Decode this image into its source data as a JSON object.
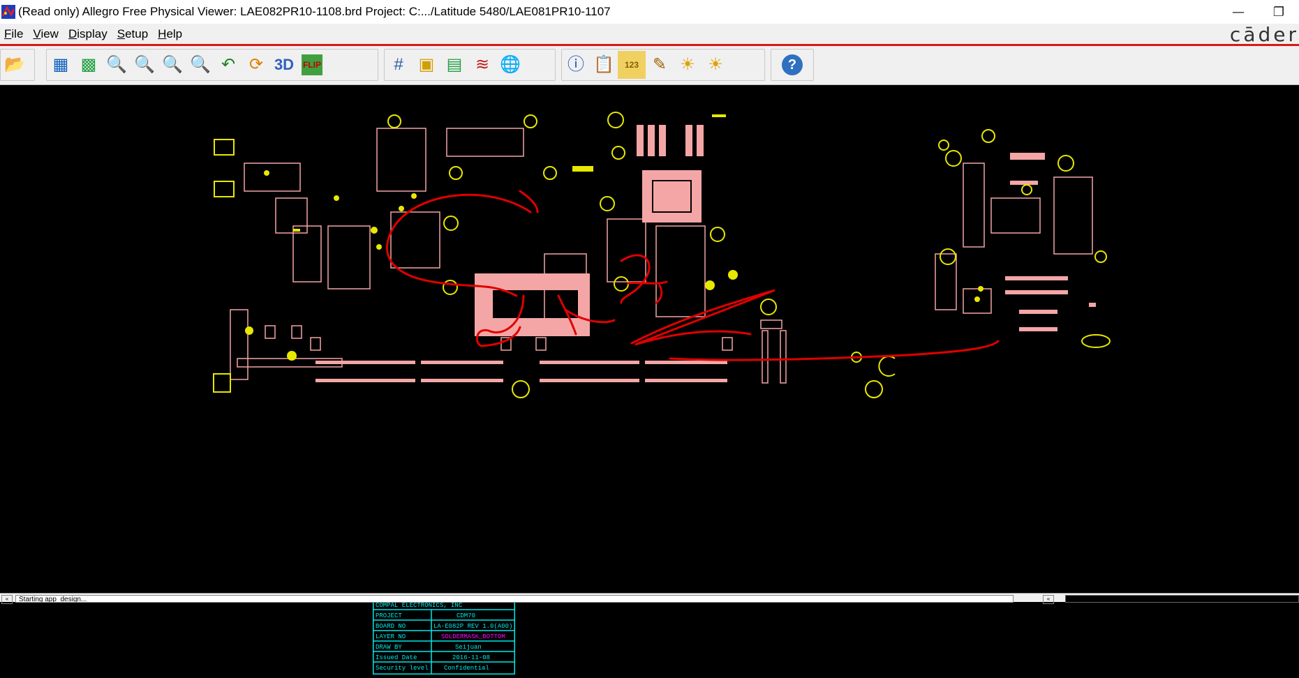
{
  "window": {
    "title": "(Read only) Allegro Free Physical Viewer: LAE082PR10-1108.brd  Project: C:.../Latitude 5480/LAE081PR10-1107",
    "minimize_glyph": "—",
    "restore_glyph": "❐"
  },
  "menu": {
    "items": [
      "File",
      "View",
      "Display",
      "Setup",
      "Help"
    ]
  },
  "brand": {
    "text": "cāder"
  },
  "toolbar": {
    "groups": [
      [
        {
          "icon": "folder-open-icon",
          "glyph": "📂"
        }
      ],
      [
        {
          "icon": "zoom-fit-icon",
          "glyph": "▦"
        },
        {
          "icon": "zoom-world-icon",
          "glyph": "▩"
        },
        {
          "icon": "zoom-points-icon",
          "glyph": "🔍"
        },
        {
          "icon": "zoom-window-icon",
          "glyph": "🔍"
        },
        {
          "icon": "zoom-in-icon",
          "glyph": "🔍"
        },
        {
          "icon": "zoom-out-icon",
          "glyph": "🔍"
        },
        {
          "icon": "zoom-previous-icon",
          "glyph": "↶"
        },
        {
          "icon": "redraw-icon",
          "glyph": "⟳"
        },
        {
          "icon": "3d-view-icon",
          "glyph": "3D"
        },
        {
          "icon": "flip-icon",
          "glyph": "FLIP"
        }
      ],
      [
        {
          "icon": "grid-icon",
          "glyph": "#"
        },
        {
          "icon": "color-icon",
          "glyph": "▣"
        },
        {
          "icon": "layers-icon",
          "glyph": "▤"
        },
        {
          "icon": "stackup-icon",
          "glyph": "≋"
        },
        {
          "icon": "world-view-icon",
          "glyph": "🌐"
        }
      ],
      [
        {
          "icon": "info-icon",
          "glyph": "ⓘ"
        },
        {
          "icon": "report-icon",
          "glyph": "📋"
        },
        {
          "icon": "measure-icon",
          "glyph": "123"
        },
        {
          "icon": "highlight-icon",
          "glyph": "✎"
        },
        {
          "icon": "shadow-icon",
          "glyph": "☀"
        },
        {
          "icon": "brightness-icon",
          "glyph": "☀"
        }
      ],
      [
        {
          "icon": "help-icon",
          "glyph": "?"
        }
      ]
    ]
  },
  "colors": {
    "board_pink": "#f4a6a6",
    "via_yellow": "#e8e800",
    "annotation_red": "#e00000",
    "titleblock_cyan": "#00e8e8",
    "magenta": "#ff00ff"
  },
  "title_block": {
    "rows": [
      {
        "label": "COMPAL ELECTRONICS, INC",
        "value": ""
      },
      {
        "label": "PROJECT",
        "value": "CDM70"
      },
      {
        "label": "BOARD NO",
        "value": "LA-E082P REV 1.0(A00)"
      },
      {
        "label": "LAYER NO",
        "value": "SOLDERMASK_BOTTOM"
      },
      {
        "label": "DRAW BY",
        "value": "Seijuan"
      },
      {
        "label": "Issued Date",
        "value": "2016-11-08"
      },
      {
        "label": "Security level",
        "value": "Confidential"
      }
    ]
  },
  "status": {
    "text": "Starting app_design...",
    "scroll_glyph": "«"
  }
}
